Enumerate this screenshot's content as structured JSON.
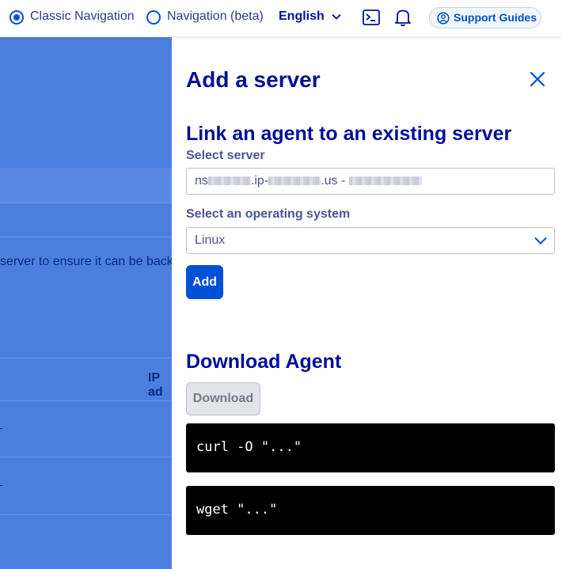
{
  "topbar": {
    "nav_classic": "Classic Navigation",
    "nav_beta": "Navigation (beta)",
    "language": "English",
    "support_label": "Support Guides",
    "icons": [
      "terminal-icon",
      "bell-icon",
      "support-icon"
    ]
  },
  "background_page": {
    "text_fragment": "server to ensure it can be back",
    "table_header_fragment": "IP ad"
  },
  "panel": {
    "title": "Add a server",
    "link_section_title": "Link an agent to an existing server",
    "select_server_label": "Select server",
    "server_value_prefix": "ns",
    "server_value_mid": ".ip-",
    "server_value_suffix": ".us - ",
    "os_label": "Select an operating system",
    "os_value": "Linux",
    "add_button": "Add",
    "download_title": "Download Agent",
    "download_button": "Download",
    "curl_command": "curl -O \"...\"",
    "wget_command": "wget \"...\""
  },
  "colors": {
    "accent": "#0050d7",
    "heading": "#000e9c",
    "overlay": "#4a7fe0"
  }
}
